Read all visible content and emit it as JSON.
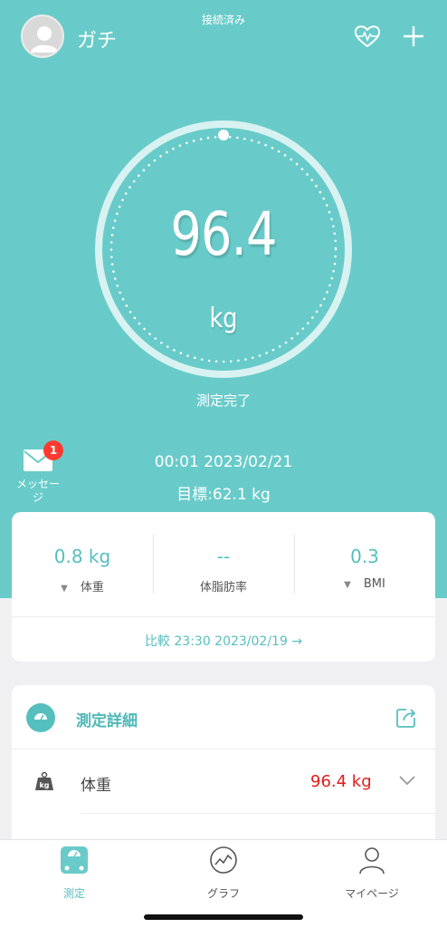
{
  "header": {
    "connection_status": "接続済み",
    "username": "ガチ",
    "icons": {
      "avatar": "person-silhouette-icon",
      "heart": "heart-pulse-icon",
      "add": "plus-icon"
    }
  },
  "measurement": {
    "weight": "96.4",
    "unit": "kg",
    "status": "測定完了",
    "time": "00:01 2023/02/21",
    "goal": "目標:62.1 kg"
  },
  "messages": {
    "label_line1": "メッセー",
    "label_line2": "ジ",
    "badge_count": "1",
    "icon": "envelope-icon"
  },
  "stats": {
    "items": [
      {
        "value": "0.8 kg",
        "label": "体重",
        "trend": "down"
      },
      {
        "value": "--",
        "label": "体脂肪率",
        "trend": "none"
      },
      {
        "value": "0.3",
        "label": "BMI",
        "trend": "down"
      }
    ],
    "compare": "比較 23:30 2023/02/19 →"
  },
  "details": {
    "title": "測定詳細",
    "rows": [
      {
        "label": "体重",
        "value": "96.4 kg",
        "icon": "kg-weight-icon"
      }
    ]
  },
  "tabbar": {
    "tabs": [
      {
        "label": "測定",
        "icon": "scale-icon",
        "active": true
      },
      {
        "label": "グラフ",
        "icon": "chart-icon",
        "active": false
      },
      {
        "label": "マイページ",
        "icon": "person-icon",
        "active": false
      }
    ]
  },
  "colors": {
    "teal": "#68cbc9",
    "accent": "#55bfbe",
    "alert_red": "#e31c1c",
    "badge_red": "#ff3b30"
  }
}
